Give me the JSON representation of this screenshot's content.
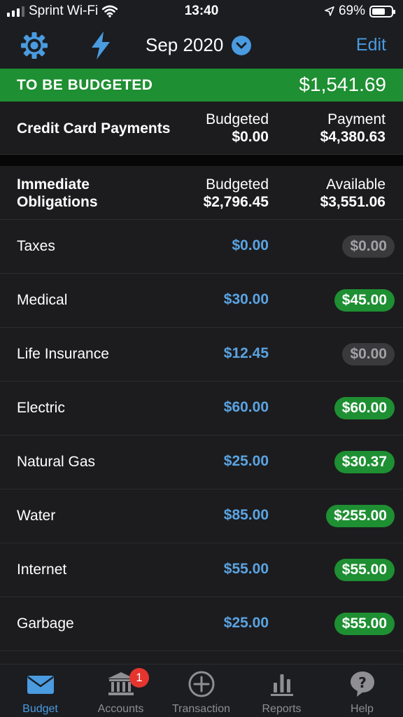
{
  "status_bar": {
    "carrier": "Sprint Wi-Fi",
    "time": "13:40",
    "battery": "69%",
    "battery_level": 0.69
  },
  "nav": {
    "month": "Sep 2020",
    "edit_label": "Edit"
  },
  "to_be_budgeted": {
    "label": "TO BE BUDGETED",
    "amount": "$1,541.69"
  },
  "credit_card": {
    "title": "Credit Card Payments",
    "budgeted_label": "Budgeted",
    "budgeted": "$0.00",
    "payment_label": "Payment",
    "payment": "$4,380.63"
  },
  "group": {
    "title_line1": "Immediate",
    "title_line2": "Obligations",
    "budgeted_label": "Budgeted",
    "budgeted": "$2,796.45",
    "available_label": "Available",
    "available": "$3,551.06"
  },
  "categories": [
    {
      "name": "Taxes",
      "budgeted": "$0.00",
      "available": "$0.00",
      "status": "gray"
    },
    {
      "name": "Medical",
      "budgeted": "$30.00",
      "available": "$45.00",
      "status": "green"
    },
    {
      "name": "Life Insurance",
      "budgeted": "$12.45",
      "available": "$0.00",
      "status": "gray"
    },
    {
      "name": "Electric",
      "budgeted": "$60.00",
      "available": "$60.00",
      "status": "green"
    },
    {
      "name": "Natural Gas",
      "budgeted": "$25.00",
      "available": "$30.37",
      "status": "green"
    },
    {
      "name": "Water",
      "budgeted": "$85.00",
      "available": "$255.00",
      "status": "green"
    },
    {
      "name": "Internet",
      "budgeted": "$55.00",
      "available": "$55.00",
      "status": "green"
    },
    {
      "name": "Garbage",
      "budgeted": "$25.00",
      "available": "$55.00",
      "status": "green"
    }
  ],
  "tabs": [
    {
      "label": "Budget",
      "icon": "envelope-icon",
      "active": true
    },
    {
      "label": "Accounts",
      "icon": "bank-icon",
      "badge": "1"
    },
    {
      "label": "Transaction",
      "icon": "plus-circle-icon"
    },
    {
      "label": "Reports",
      "icon": "bar-chart-icon"
    },
    {
      "label": "Help",
      "icon": "question-bubble-icon"
    }
  ],
  "colors": {
    "accent_blue": "#4a9be0",
    "green": "#1e8f32",
    "gray_pill": "#3a3a3c",
    "badge_red": "#e4352f",
    "background": "#1c1c1e"
  }
}
